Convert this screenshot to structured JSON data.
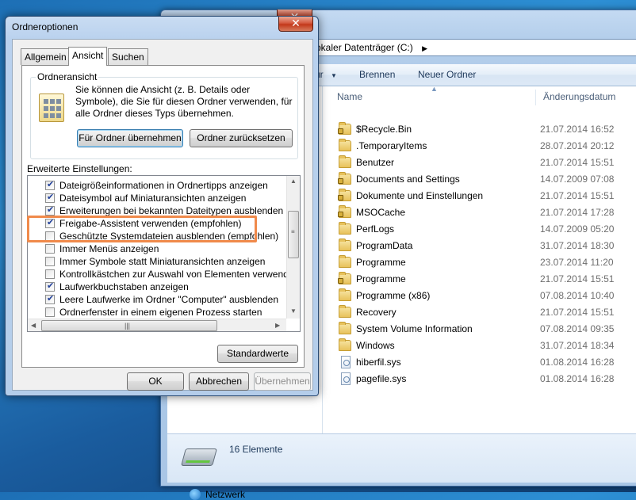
{
  "explorer": {
    "close_glyph": "✕",
    "address": "okaler Datenträger (C:)",
    "address_chevron": "▶",
    "toolbar": {
      "organize_fragment": "ür",
      "organize_arrow": "▼",
      "burn": "Brennen",
      "new_folder": "Neuer Ordner"
    },
    "columns": {
      "name": "Name",
      "date": "Änderungsdatum",
      "sort_arrow": "▲"
    },
    "files": [
      {
        "name": "$Recycle.Bin",
        "date": "21.07.2014 16:52",
        "icon": "folder-lock-icon"
      },
      {
        "name": ".TemporaryItems",
        "date": "28.07.2014 20:12",
        "icon": "folder-icon"
      },
      {
        "name": "Benutzer",
        "date": "21.07.2014 15:51",
        "icon": "folder-icon"
      },
      {
        "name": "Documents and Settings",
        "date": "14.07.2009 07:08",
        "icon": "folder-lock-icon"
      },
      {
        "name": "Dokumente und Einstellungen",
        "date": "21.07.2014 15:51",
        "icon": "folder-lock-icon"
      },
      {
        "name": "MSOCache",
        "date": "21.07.2014 17:28",
        "icon": "folder-lock-icon"
      },
      {
        "name": "PerfLogs",
        "date": "14.07.2009 05:20",
        "icon": "folder-icon"
      },
      {
        "name": "ProgramData",
        "date": "31.07.2014 18:30",
        "icon": "folder-icon"
      },
      {
        "name": "Programme",
        "date": "23.07.2014 11:20",
        "icon": "folder-icon"
      },
      {
        "name": "Programme",
        "date": "21.07.2014 15:51",
        "icon": "folder-lock-icon"
      },
      {
        "name": "Programme (x86)",
        "date": "07.08.2014 10:40",
        "icon": "folder-icon"
      },
      {
        "name": "Recovery",
        "date": "21.07.2014 15:51",
        "icon": "folder-icon"
      },
      {
        "name": "System Volume Information",
        "date": "07.08.2014 09:35",
        "icon": "folder-icon"
      },
      {
        "name": "Windows",
        "date": "31.07.2014 18:34",
        "icon": "folder-icon"
      },
      {
        "name": "hiberfil.sys",
        "date": "01.08.2014 16:28",
        "icon": "system-file-icon"
      },
      {
        "name": "pagefile.sys",
        "date": "01.08.2014 16:28",
        "icon": "system-file-icon"
      }
    ],
    "nav_network": "Netzwerk",
    "status": "16 Elemente"
  },
  "dialog": {
    "title": "Ordneroptionen",
    "close_glyph": "✕",
    "tabs": [
      {
        "label": "Allgemein",
        "active": false
      },
      {
        "label": "Ansicht",
        "active": true
      },
      {
        "label": "Suchen",
        "active": false
      }
    ],
    "folder_view": {
      "legend": "Ordneransicht",
      "description": "Sie können die Ansicht (z. B. Details oder Symbole), die Sie für diesen Ordner verwenden, für alle Ordner dieses Typs übernehmen.",
      "apply_button": "Für Ordner übernehmen",
      "reset_button": "Ordner zurücksetzen"
    },
    "advanced_label": "Erweiterte Einstellungen:",
    "settings": [
      {
        "label": "Dateigrößeinformationen in Ordnertipps anzeigen",
        "checked": true
      },
      {
        "label": "Dateisymbol auf Miniaturansichten anzeigen",
        "checked": true
      },
      {
        "label": "Erweiterungen bei bekannten Dateitypen ausblenden",
        "checked": true
      },
      {
        "label": "Freigabe-Assistent verwenden (empfohlen)",
        "checked": true
      },
      {
        "label": "Geschützte Systemdateien ausblenden (empfohlen)",
        "checked": false
      },
      {
        "label": "Immer Menüs anzeigen",
        "checked": false
      },
      {
        "label": "Immer Symbole statt Miniaturansichten anzeigen",
        "checked": false
      },
      {
        "label": "Kontrollkästchen zur Auswahl von Elementen verwenden",
        "checked": false
      },
      {
        "label": "Laufwerkbuchstaben anzeigen",
        "checked": true
      },
      {
        "label": "Leere Laufwerke im Ordner \"Computer\" ausblenden",
        "checked": true
      },
      {
        "label": "Ordnerfenster in einem eigenen Prozess starten",
        "checked": false
      }
    ],
    "restore_defaults": "Standardwerte",
    "ok": "OK",
    "cancel": "Abbrechen",
    "apply": "Übernehmen",
    "highlight_color": "#f08a4b"
  }
}
